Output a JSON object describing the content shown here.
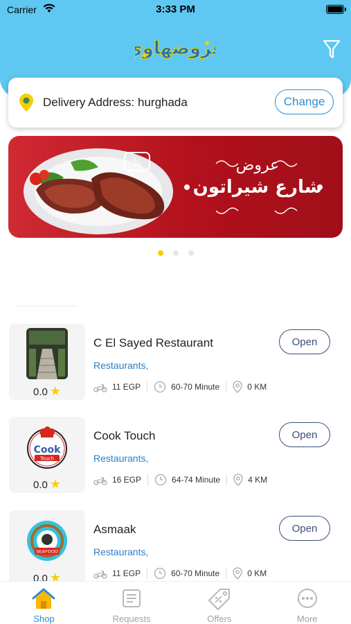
{
  "status_bar": {
    "carrier": "Carrier",
    "time": "3:33 PM"
  },
  "header": {
    "logo_text": "عروضهاوي",
    "logo_name": "app-logo"
  },
  "address": {
    "text": "Delivery Address: hurghada",
    "change_label": "Change"
  },
  "banner": {
    "line1": "عروض",
    "line2": "شارع شيراتون"
  },
  "carousel": {
    "count": 3,
    "active_index": 0
  },
  "restaurants": [
    {
      "name": "C El Sayed Restaurant",
      "category": "Restaurants,",
      "rating": "0.0",
      "delivery_fee": "11 EGP",
      "time": "60-70 Minute",
      "distance": "0 KM",
      "open_label": "Open"
    },
    {
      "name": "Cook Touch",
      "category": "Restaurants,",
      "rating": "0.0",
      "delivery_fee": "16 EGP",
      "time": "64-74 Minute",
      "distance": "4 KM",
      "open_label": "Open"
    },
    {
      "name": "Asmaak",
      "category": "Restaurants,",
      "rating": "0.0",
      "delivery_fee": "11 EGP",
      "time": "60-70 Minute",
      "distance": "0 KM",
      "open_label": "Open"
    }
  ],
  "tabs": [
    {
      "label": "Shop",
      "icon": "home-icon",
      "active": true
    },
    {
      "label": "Requests",
      "icon": "receipt-icon",
      "active": false
    },
    {
      "label": "Offers",
      "icon": "tag-icon",
      "active": false
    },
    {
      "label": "More",
      "icon": "more-icon",
      "active": false
    }
  ],
  "colors": {
    "header": "#5ec8f2",
    "accent": "#2a8ad6",
    "star": "#f6cf00",
    "banner": "#b2111c"
  }
}
